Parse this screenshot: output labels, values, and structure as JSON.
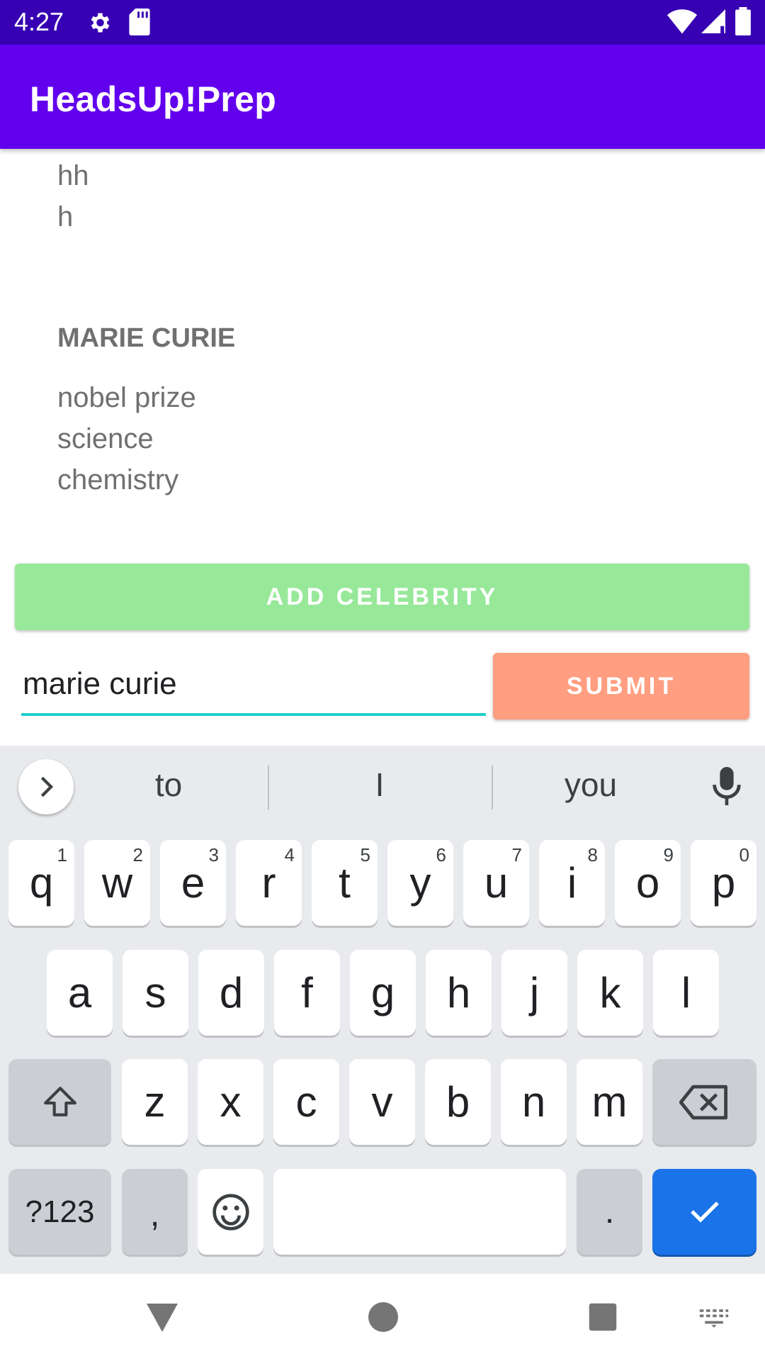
{
  "status_bar": {
    "time": "4:27"
  },
  "app_bar": {
    "title": "HeadsUp!Prep"
  },
  "list": {
    "partial_item_lines": [
      "hh",
      "h"
    ],
    "celebrity": {
      "name": "MARIE CURIE",
      "clues": [
        "nobel prize",
        "science",
        "chemistry"
      ]
    }
  },
  "actions": {
    "add_label": "ADD CELEBRITY",
    "submit_label": "SUBMIT",
    "add_color": "#98E89A",
    "submit_color": "#FF9E80"
  },
  "input": {
    "value": "marie curie"
  },
  "keyboard": {
    "suggestions": [
      "to",
      "I",
      "you"
    ],
    "row1": [
      {
        "k": "q",
        "h": "1"
      },
      {
        "k": "w",
        "h": "2"
      },
      {
        "k": "e",
        "h": "3"
      },
      {
        "k": "r",
        "h": "4"
      },
      {
        "k": "t",
        "h": "5"
      },
      {
        "k": "y",
        "h": "6"
      },
      {
        "k": "u",
        "h": "7"
      },
      {
        "k": "i",
        "h": "8"
      },
      {
        "k": "o",
        "h": "9"
      },
      {
        "k": "p",
        "h": "0"
      }
    ],
    "row2": [
      "a",
      "s",
      "d",
      "f",
      "g",
      "h",
      "j",
      "k",
      "l"
    ],
    "row3": [
      "z",
      "x",
      "c",
      "v",
      "b",
      "n",
      "m"
    ],
    "symbols_label": "?123",
    "comma": ",",
    "period": "."
  },
  "icons": {
    "settings": "gear-icon",
    "sd_card": "sd-card-icon",
    "wifi": "wifi-icon",
    "signal": "signal-icon",
    "battery": "battery-icon",
    "expand": "chevron-right-icon",
    "mic": "mic-icon",
    "shift": "shift-icon",
    "backspace": "backspace-icon",
    "emoji": "emoji-icon",
    "done": "check-icon",
    "back": "nav-back-icon",
    "home": "nav-home-icon",
    "recents": "nav-recents-icon",
    "keyboard_switch": "keyboard-icon"
  }
}
